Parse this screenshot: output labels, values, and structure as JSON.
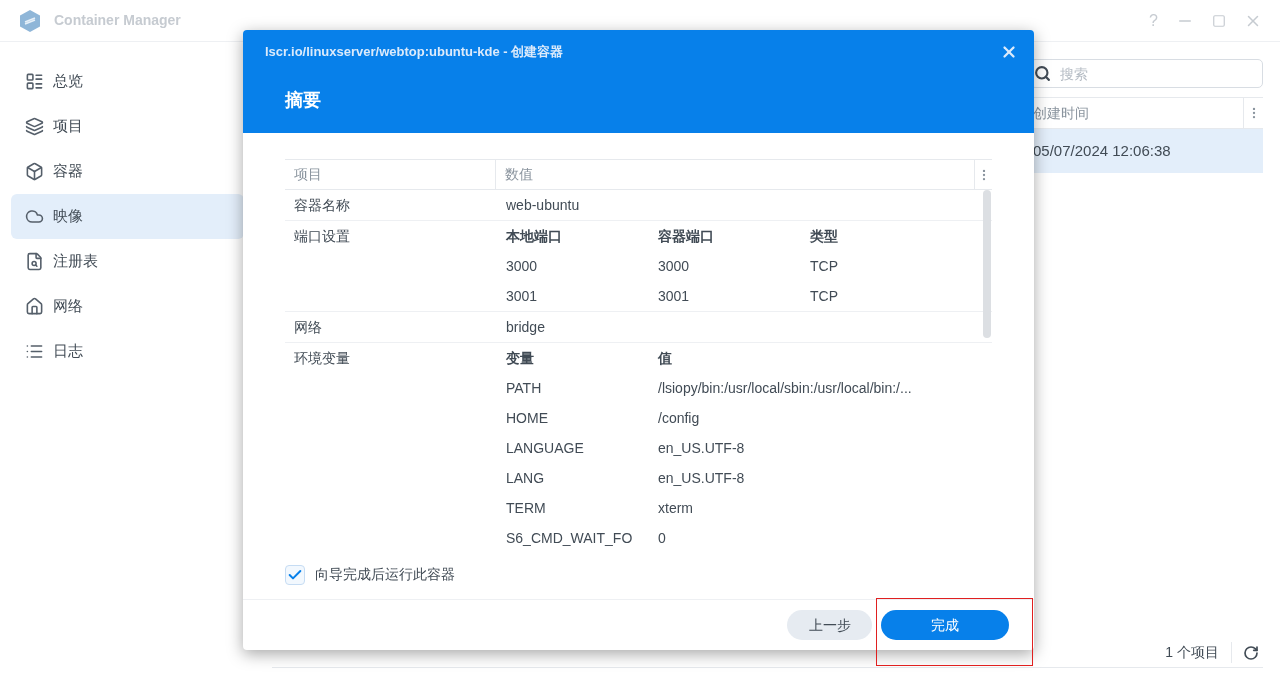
{
  "app": {
    "title": "Container Manager",
    "help_label": "?"
  },
  "sidebar": {
    "items": [
      {
        "label": "总览",
        "selected": false
      },
      {
        "label": "项目",
        "selected": false
      },
      {
        "label": "容器",
        "selected": false
      },
      {
        "label": "映像",
        "selected": true
      },
      {
        "label": "注册表",
        "selected": false
      },
      {
        "label": "网络",
        "selected": false
      },
      {
        "label": "日志",
        "selected": false
      }
    ]
  },
  "search": {
    "placeholder": "搜索"
  },
  "table": {
    "columns": [
      "创建时间"
    ],
    "rows": [
      {
        "cells": [
          "05/07/2024 12:06:38"
        ],
        "selected": true
      }
    ]
  },
  "status_bar": {
    "count": "1 个项目"
  },
  "dialog": {
    "title": "lscr.io/linuxserver/webtop:ubuntu-kde - 创建容器",
    "step": "摘要",
    "summary": {
      "columns": [
        "项目",
        "数值"
      ],
      "rows": [
        {
          "kind": "text",
          "label": "容器名称",
          "value": "web-ubuntu"
        },
        {
          "kind": "grid",
          "label": "端口设置",
          "headers": [
            "本地端口",
            "容器端口",
            "类型"
          ],
          "rows": [
            [
              "3000",
              "3000",
              "TCP"
            ],
            [
              "3001",
              "3001",
              "TCP"
            ]
          ]
        },
        {
          "kind": "text",
          "label": "网络",
          "value": "bridge"
        },
        {
          "kind": "grid",
          "label": "环境变量",
          "headers": [
            "变量",
            "值"
          ],
          "rows": [
            [
              "PATH",
              "/lsiopy/bin:/usr/local/sbin:/usr/local/bin:/..."
            ],
            [
              "HOME",
              "/config"
            ],
            [
              "LANGUAGE",
              "en_US.UTF-8"
            ],
            [
              "LANG",
              "en_US.UTF-8"
            ],
            [
              "TERM",
              "xterm"
            ],
            [
              "S6_CMD_WAIT_FO",
              "0"
            ]
          ]
        }
      ]
    },
    "run_after": {
      "label": "向导完成后运行此容器",
      "checked": true
    },
    "buttons": [
      {
        "label": "上一步",
        "kind": "secondary"
      },
      {
        "label": "完成",
        "kind": "primary"
      }
    ]
  },
  "annotations": [
    {
      "kind": "frame"
    }
  ]
}
